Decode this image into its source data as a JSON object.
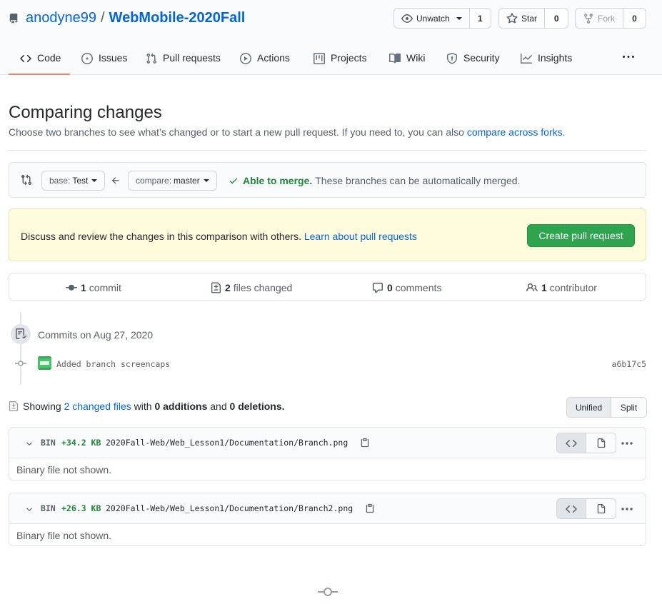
{
  "repo": {
    "owner": "anodyne99",
    "separator": "/",
    "name": "WebMobile-2020Fall"
  },
  "actions": {
    "watch": {
      "label": "Unwatch",
      "count": "1"
    },
    "star": {
      "label": "Star",
      "count": "0"
    },
    "fork": {
      "label": "Fork",
      "count": "0"
    }
  },
  "nav": [
    {
      "label": "Code",
      "icon": "code-icon",
      "active": true
    },
    {
      "label": "Issues",
      "icon": "issue-icon"
    },
    {
      "label": "Pull requests",
      "icon": "pull-request-icon"
    },
    {
      "label": "Actions",
      "icon": "play-icon"
    },
    {
      "label": "Projects",
      "icon": "project-icon"
    },
    {
      "label": "Wiki",
      "icon": "book-icon"
    },
    {
      "label": "Security",
      "icon": "shield-icon"
    },
    {
      "label": "Insights",
      "icon": "graph-icon"
    }
  ],
  "compare": {
    "title": "Comparing changes",
    "subtitle": "Choose two branches to see what’s changed or to start a new pull request. If you need to, you can also",
    "subtitle_link": "compare across forks",
    "subtitle_end": ".",
    "base_label": "base:",
    "base_value": "Test",
    "compare_label": "compare:",
    "compare_value": "master",
    "merge_ok": "Able to merge.",
    "merge_text": "These branches can be automatically merged."
  },
  "flash": {
    "text": "Discuss and review the changes in this comparison with others.",
    "link": "Learn about pull requests",
    "button": "Create pull request"
  },
  "stats": {
    "commits": {
      "count": "1",
      "label": "commit"
    },
    "files": {
      "count": "2",
      "label": "files changed"
    },
    "comments": {
      "count": "0",
      "label": "comments"
    },
    "contributors": {
      "count": "1",
      "label": "contributor"
    }
  },
  "timeline": {
    "commits_on": "Commits on Aug 27, 2020",
    "commit_message": "Added branch screencaps",
    "commit_sha": "a6b17c5"
  },
  "summary": {
    "showing": "Showing",
    "changed_link": "2 changed files",
    "with": "with",
    "additions": "0 additions",
    "and": "and",
    "deletions": "0 deletions.",
    "unified": "Unified",
    "split": "Split"
  },
  "files": [
    {
      "type": "BIN",
      "size": "+34.2 KB",
      "path": "2020Fall-Web/Web_Lesson1/Documentation/Branch.png",
      "body": "Binary file not shown."
    },
    {
      "type": "BIN",
      "size": "+26.3 KB",
      "path": "2020Fall-Web/Web_Lesson1/Documentation/Branch2.png",
      "body": "Binary file not shown."
    }
  ],
  "colors": {
    "link": "#0366d6",
    "success": "#2ea44f",
    "flash_bg": "#fffbdd",
    "active_tab": "#f9826c"
  }
}
